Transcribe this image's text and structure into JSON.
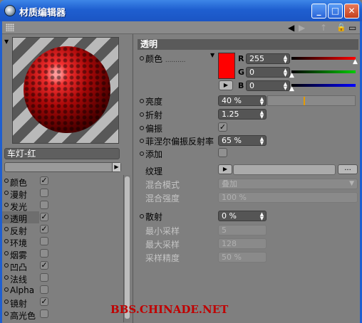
{
  "window": {
    "title": "材质编辑器",
    "min": "_",
    "max": "□",
    "close": "✕"
  },
  "toolbar": {
    "back_icon": "◀",
    "fwd_icon": "▶",
    "up_icon": "↑",
    "lock_icon": "🔒",
    "new_icon": "▭"
  },
  "material": {
    "name": "车灯-红"
  },
  "channels": [
    {
      "label": "颜色",
      "checked": true
    },
    {
      "label": "漫射",
      "checked": false
    },
    {
      "label": "发光",
      "checked": false
    },
    {
      "label": "透明",
      "checked": true,
      "selected": true
    },
    {
      "label": "反射",
      "checked": true
    },
    {
      "label": "环境",
      "checked": false
    },
    {
      "label": "烟雾",
      "checked": false
    },
    {
      "label": "凹凸",
      "checked": true
    },
    {
      "label": "法线",
      "checked": false
    },
    {
      "label": "Alpha",
      "checked": false
    },
    {
      "label": "镜射",
      "checked": true
    },
    {
      "label": "高光色",
      "checked": false
    }
  ],
  "section": {
    "title": "透明",
    "color_label": "颜色",
    "color_dots": "..........",
    "swatch_color": "#ff0000",
    "r_label": "R",
    "g_label": "G",
    "b_label": "B",
    "r_value": "255",
    "g_value": "0",
    "b_value": "0",
    "brightness_label": "亮度",
    "brightness_value": "40 %",
    "refraction_label": "折射",
    "refraction_value": "1.25",
    "polarize_label": "偏振",
    "polarize_checked": "✓",
    "fresnel_label": "菲涅尔偏振反射率",
    "fresnel_value": "65 %",
    "additive_label": "添加",
    "additive_checked": "",
    "texture_label": "纹理",
    "texture_btn": "...",
    "mix_mode_label": "混合模式",
    "mix_mode_value": "叠加",
    "mix_strength_label": "混合强度",
    "mix_strength_value": "100 %",
    "blur_label": "散射",
    "blur_value": "0 %",
    "min_samples_label": "最小采样",
    "min_samples_value": "5",
    "max_samples_label": "最大采样",
    "max_samples_value": "128",
    "accuracy_label": "采样精度",
    "accuracy_value": "50 %"
  },
  "watermark": "BBS.CHINADE.NET"
}
